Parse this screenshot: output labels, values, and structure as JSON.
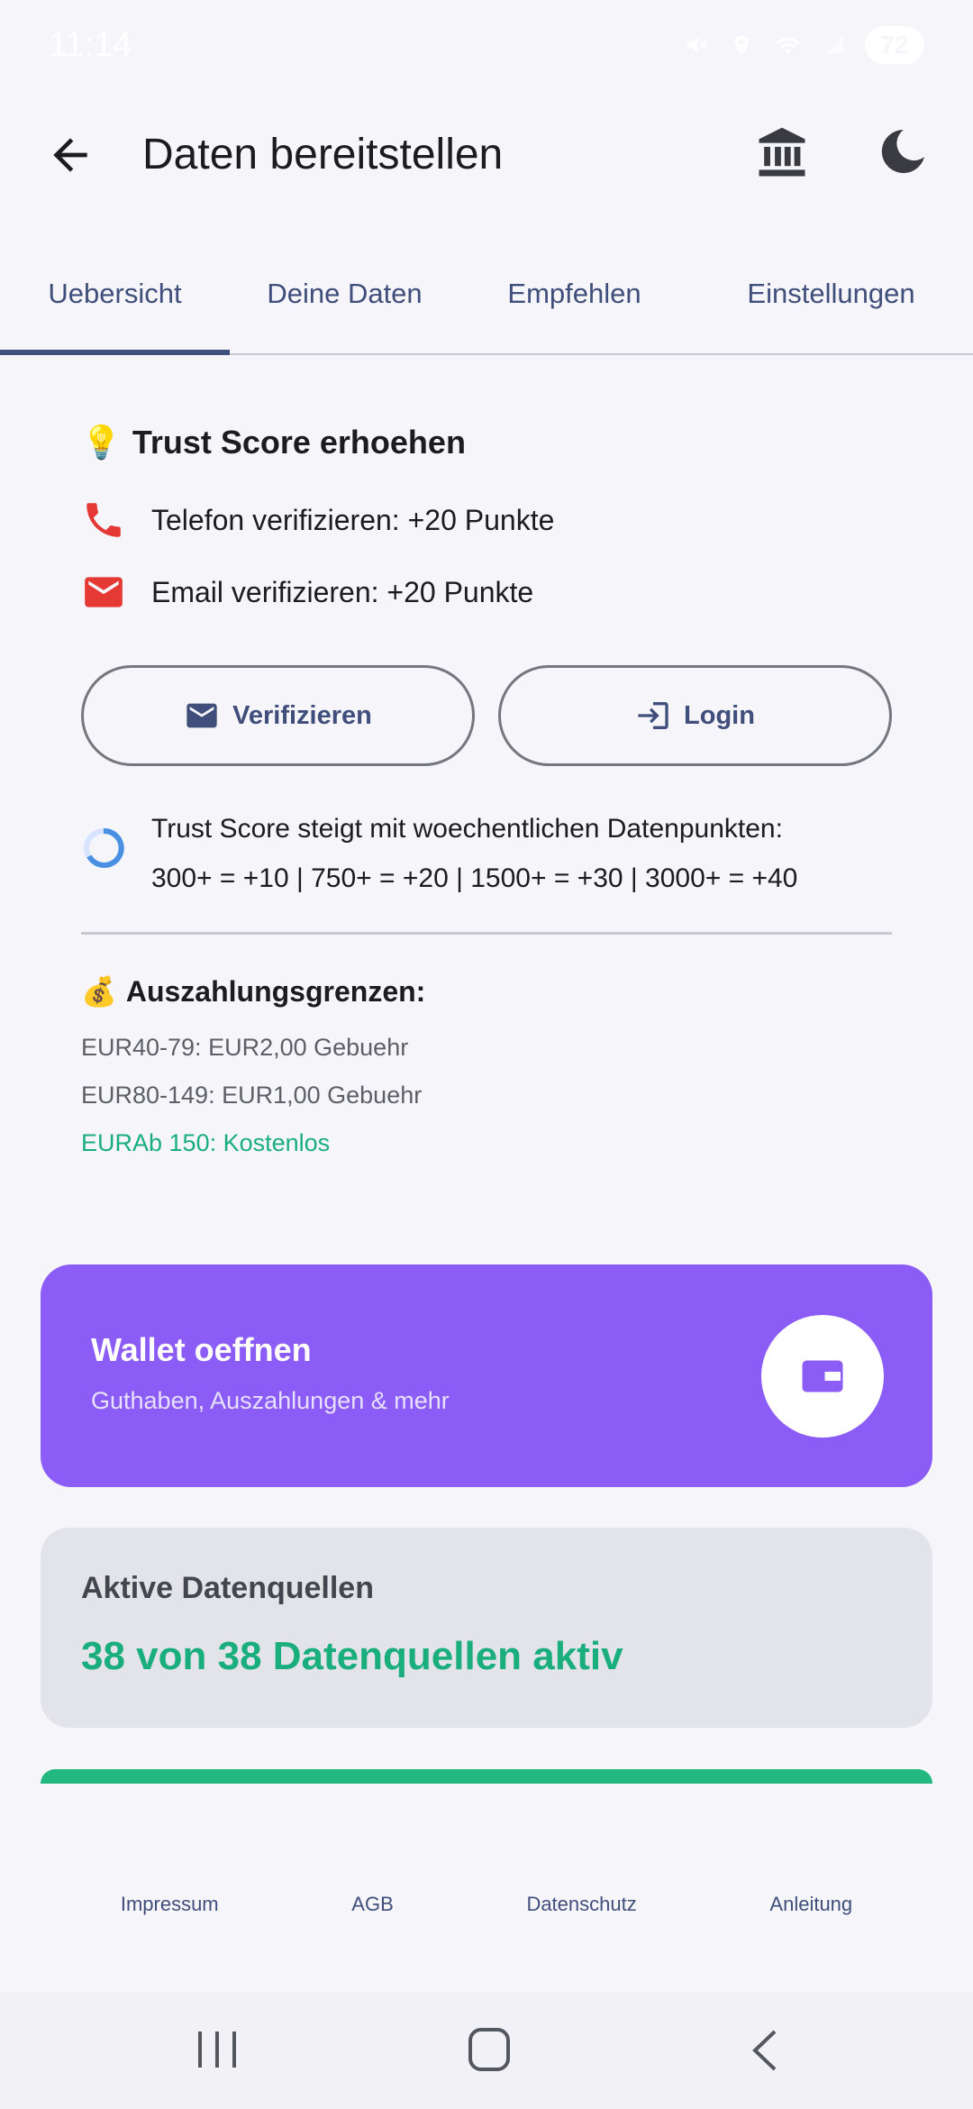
{
  "status_bar": {
    "time": "11:14",
    "battery": "72"
  },
  "header": {
    "title": "Daten bereitstellen"
  },
  "tabs": [
    {
      "label": "Uebersicht",
      "active": true
    },
    {
      "label": "Deine Daten",
      "active": false
    },
    {
      "label": "Empfehlen",
      "active": false
    },
    {
      "label": "Einstellungen",
      "active": false
    }
  ],
  "trust": {
    "emoji": "💡",
    "title": "Trust Score erhoehen",
    "phone_label": "Telefon verifizieren: +20 Punkte",
    "email_label": "Email verifizieren: +20 Punkte",
    "verify_button": "Verifizieren",
    "login_button": "Login",
    "progress_line1": "Trust Score steigt mit woechentlichen Datenpunkten:",
    "progress_line2": "300+ = +10 | 750+ = +20 | 1500+ = +30 | 3000+ = +40"
  },
  "payout": {
    "emoji": "💰",
    "title": "Auszahlungsgrenzen:",
    "line1": "EUR40-79: EUR2,00 Gebuehr",
    "line2": "EUR80-149: EUR1,00 Gebuehr",
    "line3": "EURAb 150: Kostenlos"
  },
  "wallet": {
    "title": "Wallet oeffnen",
    "subtitle": "Guthaben, Auszahlungen & mehr"
  },
  "sources": {
    "title": "Aktive Datenquellen",
    "value": "38 von 38 Datenquellen aktiv"
  },
  "footer": {
    "impressum": "Impressum",
    "agb": "AGB",
    "datenschutz": "Datenschutz",
    "anleitung": "Anleitung"
  },
  "colors": {
    "primary": "#3F4E7A",
    "wallet": "#8B5CF6",
    "green": "#1AAE7D",
    "red": "#E53935"
  }
}
